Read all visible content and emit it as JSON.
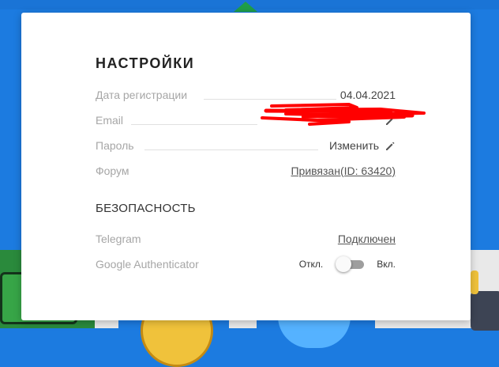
{
  "settings": {
    "title": "НАСТРОЙКИ",
    "registration_label": "Дата регистрации",
    "registration_date": "04.04.2021",
    "email_label": "Email",
    "password_label": "Пароль",
    "password_action": "Изменить",
    "forum_label": "Форум",
    "forum_value": "Привязан(ID: 63420)"
  },
  "security": {
    "title": "БЕЗОПАСНОСТЬ",
    "telegram_label": "Telegram",
    "telegram_value": "Подключен",
    "ga_label": "Google Authenticator",
    "ga_off_label": "Откл.",
    "ga_on_label": "Вкл.",
    "ga_enabled": false
  },
  "icons": {
    "edit": "pencil-icon"
  },
  "colors": {
    "background": "#1c7be0",
    "redaction": "#ff0000",
    "label": "#a6a6a6",
    "toggle_track": "#9e9e9e",
    "arrow": "#1f9e48"
  }
}
